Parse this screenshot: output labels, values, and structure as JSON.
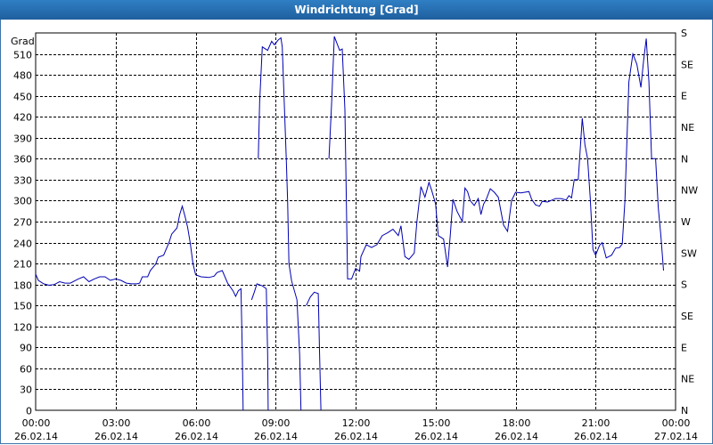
{
  "window": {
    "title": "Windrichtung [Grad]"
  },
  "colors": {
    "line": "#0000b0",
    "grid": "#000000",
    "titlebar": "#2a72b8"
  },
  "chart_data": {
    "type": "line",
    "title": "Windrichtung [Grad]",
    "ylabel": "Grad",
    "xlabel": "",
    "ylim": [
      0,
      540
    ],
    "yticks": [
      0,
      30,
      60,
      90,
      120,
      150,
      180,
      210,
      240,
      270,
      300,
      330,
      360,
      390,
      420,
      450,
      480,
      510
    ],
    "right_axis_labels": [
      "N",
      "NE",
      "E",
      "SE",
      "S",
      "SW",
      "W",
      "NW",
      "N",
      "NE",
      "E",
      "SE",
      "S"
    ],
    "x_tick_labels": [
      {
        "time": "00:00",
        "date": "26.02.14"
      },
      {
        "time": "03:00",
        "date": "26.02.14"
      },
      {
        "time": "06:00",
        "date": "26.02.14"
      },
      {
        "time": "09:00",
        "date": "26.02.14"
      },
      {
        "time": "12:00",
        "date": "26.02.14"
      },
      {
        "time": "15:00",
        "date": "26.02.14"
      },
      {
        "time": "18:00",
        "date": "26.02.14"
      },
      {
        "time": "21:00",
        "date": "26.02.14"
      },
      {
        "time": "00:00",
        "date": "27.02.14"
      }
    ],
    "grid": true,
    "xlim_hours": [
      0,
      24
    ],
    "series": [
      {
        "segments": [
          [
            [
              0.0,
              195
            ],
            [
              0.1,
              186
            ],
            [
              0.3,
              181
            ],
            [
              0.5,
              179
            ],
            [
              0.7,
              180
            ],
            [
              0.9,
              184
            ],
            [
              1.1,
              182
            ],
            [
              1.3,
              182
            ],
            [
              1.6,
              188
            ],
            [
              1.8,
              191
            ],
            [
              2.0,
              184
            ],
            [
              2.2,
              188
            ],
            [
              2.4,
              191
            ],
            [
              2.6,
              191
            ],
            [
              2.8,
              186
            ],
            [
              3.0,
              188
            ],
            [
              3.2,
              186
            ],
            [
              3.4,
              182
            ],
            [
              3.6,
              181
            ],
            [
              3.8,
              181
            ],
            [
              3.9,
              182
            ],
            [
              4.0,
              191
            ],
            [
              4.2,
              191
            ],
            [
              4.3,
              200
            ],
            [
              4.5,
              209
            ],
            [
              4.6,
              219
            ],
            [
              4.8,
              222
            ],
            [
              5.0,
              240
            ],
            [
              5.1,
              252
            ],
            [
              5.3,
              261
            ],
            [
              5.4,
              280
            ],
            [
              5.5,
              292
            ],
            [
              5.6,
              278
            ],
            [
              5.7,
              262
            ],
            [
              5.8,
              239
            ],
            [
              5.9,
              210
            ],
            [
              6.0,
              194
            ],
            [
              6.2,
              191
            ],
            [
              6.5,
              190
            ],
            [
              6.7,
              192
            ],
            [
              6.8,
              197
            ],
            [
              7.0,
              200
            ],
            [
              7.2,
              182
            ],
            [
              7.4,
              171
            ],
            [
              7.5,
              163
            ],
            [
              7.6,
              171
            ],
            [
              7.7,
              174
            ],
            [
              7.75,
              80
            ],
            [
              7.78,
              0
            ]
          ],
          [
            [
              8.1,
              158
            ],
            [
              8.2,
              169
            ],
            [
              8.3,
              181
            ],
            [
              8.5,
              178
            ],
            [
              8.65,
              174
            ],
            [
              8.7,
              80
            ],
            [
              8.72,
              0
            ]
          ],
          [
            [
              8.35,
              360
            ],
            [
              8.4,
              440
            ],
            [
              8.5,
              520
            ],
            [
              8.7,
              515
            ],
            [
              8.85,
              528
            ],
            [
              8.95,
              523
            ],
            [
              9.1,
              530
            ],
            [
              9.2,
              533
            ],
            [
              9.25,
              520
            ],
            [
              9.4,
              360
            ],
            [
              9.45,
              300
            ],
            [
              9.5,
              210
            ],
            [
              9.6,
              185
            ],
            [
              9.8,
              158
            ],
            [
              9.9,
              80
            ],
            [
              9.95,
              0
            ]
          ],
          [
            [
              10.15,
              150
            ],
            [
              10.3,
              162
            ],
            [
              10.45,
              169
            ],
            [
              10.6,
              167
            ],
            [
              10.65,
              80
            ],
            [
              10.7,
              0
            ]
          ],
          [
            [
              11.0,
              360
            ],
            [
              11.1,
              440
            ],
            [
              11.2,
              535
            ],
            [
              11.3,
              525
            ],
            [
              11.4,
              515
            ],
            [
              11.5,
              517
            ],
            [
              11.6,
              430
            ],
            [
              11.7,
              188
            ],
            [
              11.85,
              188
            ],
            [
              12.0,
              203
            ],
            [
              12.15,
              199
            ],
            [
              12.2,
              220
            ],
            [
              12.4,
              237
            ],
            [
              12.6,
              233
            ],
            [
              12.8,
              237
            ],
            [
              13.0,
              250
            ],
            [
              13.2,
              254
            ],
            [
              13.4,
              259
            ],
            [
              13.6,
              250
            ],
            [
              13.7,
              264
            ],
            [
              13.85,
              220
            ],
            [
              14.0,
              216
            ],
            [
              14.2,
              225
            ],
            [
              14.3,
              270
            ],
            [
              14.45,
              320
            ],
            [
              14.6,
              305
            ],
            [
              14.75,
              326
            ],
            [
              14.85,
              315
            ],
            [
              15.0,
              295
            ],
            [
              15.1,
              250
            ],
            [
              15.3,
              245
            ],
            [
              15.45,
              205
            ],
            [
              15.55,
              250
            ],
            [
              15.65,
              302
            ],
            [
              15.8,
              285
            ],
            [
              16.0,
              270
            ],
            [
              16.1,
              318
            ],
            [
              16.2,
              313
            ],
            [
              16.3,
              300
            ],
            [
              16.45,
              293
            ],
            [
              16.6,
              303
            ],
            [
              16.7,
              280
            ],
            [
              16.8,
              295
            ],
            [
              16.9,
              302
            ],
            [
              17.05,
              317
            ],
            [
              17.2,
              312
            ],
            [
              17.35,
              305
            ],
            [
              17.55,
              265
            ],
            [
              17.7,
              256
            ],
            [
              17.85,
              300
            ],
            [
              18.0,
              312
            ],
            [
              18.2,
              311
            ],
            [
              18.5,
              313
            ],
            [
              18.6,
              302
            ],
            [
              18.75,
              294
            ],
            [
              18.9,
              292
            ],
            [
              19.0,
              299
            ],
            [
              19.2,
              298
            ],
            [
              19.5,
              303
            ],
            [
              19.7,
              303
            ],
            [
              19.9,
              301
            ],
            [
              20.0,
              307
            ],
            [
              20.1,
              304
            ],
            [
              20.2,
              330
            ],
            [
              20.35,
              330
            ],
            [
              20.5,
              418
            ],
            [
              20.6,
              380
            ],
            [
              20.7,
              360
            ],
            [
              20.8,
              303
            ],
            [
              20.9,
              230
            ],
            [
              21.0,
              222
            ],
            [
              21.15,
              236
            ],
            [
              21.25,
              240
            ],
            [
              21.4,
              218
            ],
            [
              21.6,
              222
            ],
            [
              21.75,
              232
            ],
            [
              21.9,
              233
            ],
            [
              22.0,
              238
            ],
            [
              22.1,
              300
            ],
            [
              22.25,
              470
            ],
            [
              22.4,
              510
            ],
            [
              22.55,
              495
            ],
            [
              22.7,
              462
            ],
            [
              22.8,
              500
            ],
            [
              22.9,
              532
            ],
            [
              23.0,
              470
            ],
            [
              23.1,
              360
            ],
            [
              23.25,
              360
            ],
            [
              23.35,
              290
            ],
            [
              23.45,
              250
            ],
            [
              23.55,
              200
            ]
          ]
        ]
      }
    ]
  }
}
